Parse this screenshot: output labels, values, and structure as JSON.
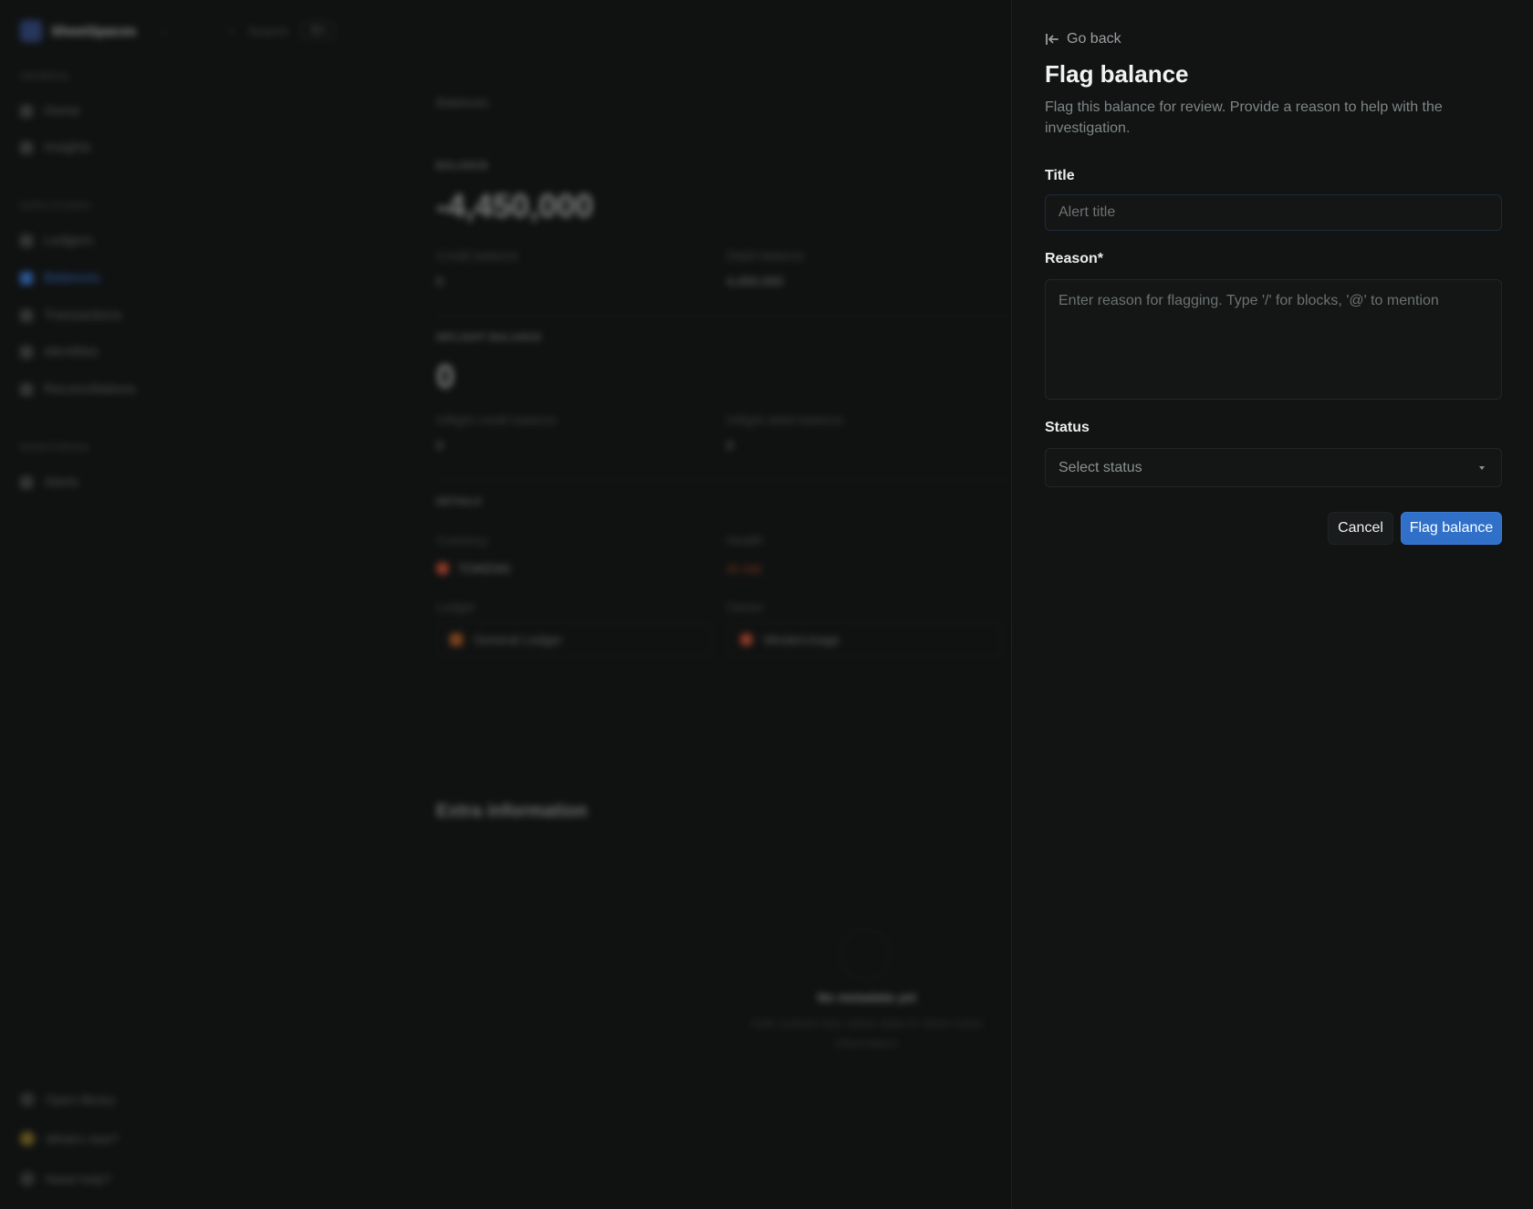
{
  "background": {
    "workspace_name": "SheetSpaces",
    "search_label": "Search",
    "search_shortcut": "⌘K",
    "sections": [
      {
        "label": "GENERAL",
        "items": [
          "Home",
          "Insights"
        ]
      },
      {
        "label": "DATA STUDIO",
        "items": [
          "Ledgers",
          "Balances",
          "Transactions",
          "Identities",
          "Reconciliations"
        ]
      },
      {
        "label": "MONITORING",
        "items": [
          "Alerts"
        ]
      }
    ],
    "active_item": "Balances",
    "footer_items": [
      "Open library",
      "What's new?",
      "Need help?"
    ],
    "breadcrumb": "Balances",
    "balance_label": "BALANCE",
    "balance_value": "-4,450,000",
    "credit_label": "Credit balance",
    "credit_value": "0",
    "debit_label": "Debit balance",
    "debit_value": "4,450,000",
    "inflight_label": "INFLIGHT BALANCE",
    "inflight_value": "0",
    "inflight_credit_label": "Inflight credit balance",
    "inflight_credit_value": "0",
    "inflight_debit_label": "Inflight debit balance",
    "inflight_debit_value": "0",
    "details_label": "DETAILS",
    "currency_label": "Currency",
    "currency_value": "TOKENS",
    "health_label": "Health",
    "health_value": "At risk",
    "ledger_label": "Ledger",
    "ledger_value": "General Ledger",
    "owner_label": "Owner",
    "owner_value": "MinderUsage",
    "extra_title": "Extra information",
    "empty_title": "No metadata yet",
    "empty_desc": "Add custom key value data to store extra information"
  },
  "panel": {
    "back_label": "Go back",
    "title": "Flag balance",
    "description": "Flag this balance for review. Provide a reason to help with the investigation.",
    "title_field": {
      "label": "Title",
      "placeholder": "Alert title",
      "value": ""
    },
    "reason_field": {
      "label": "Reason*",
      "placeholder": "Enter reason for flagging. Type '/' for blocks, '@' to mention",
      "value": ""
    },
    "status_field": {
      "label": "Status",
      "value": "Select status"
    },
    "cancel_label": "Cancel",
    "submit_label": "Flag balance"
  },
  "colors": {
    "accent": "#3070c8",
    "background": "#101212",
    "panel": "#121414"
  }
}
